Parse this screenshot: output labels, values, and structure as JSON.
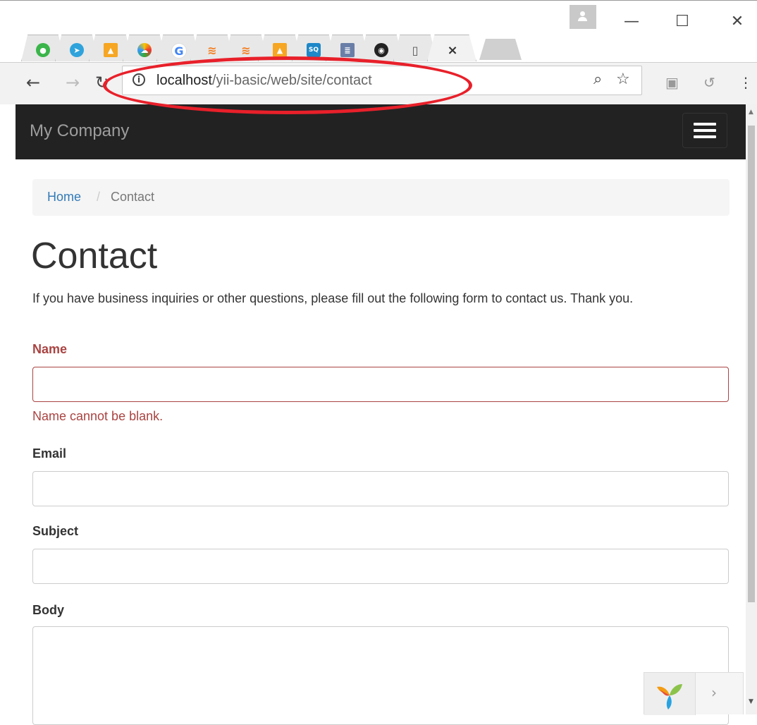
{
  "browser": {
    "address_host": "localhost",
    "address_path": "/yii-basic/web/site/contact",
    "tabs": [
      "whatsapp",
      "telegram",
      "phpmyadmin",
      "weather",
      "google",
      "stackoverflow",
      "stackoverflow",
      "phpmyadmin",
      "sq",
      "archive",
      "github",
      "blank-page",
      "active"
    ],
    "close_tab_glyph": "×",
    "window_controls": {
      "minimize": "—",
      "maximize": "☐",
      "close": "✕"
    },
    "annotation_color": "#e8202a"
  },
  "navbar": {
    "brand": "My Company",
    "background": "#222222"
  },
  "breadcrumb": {
    "home": "Home",
    "separator": "/",
    "current": "Contact"
  },
  "page": {
    "title": "Contact",
    "intro": "If you have business inquiries or other questions, please fill out the following form to contact us. Thank you."
  },
  "form": {
    "name_label": "Name",
    "name_value": "",
    "name_error": "Name cannot be blank.",
    "email_label": "Email",
    "email_value": "",
    "subject_label": "Subject",
    "subject_value": "",
    "body_label": "Body",
    "body_value": "",
    "error_color": "#a94442"
  },
  "debug_toolbar": {
    "logo": "yii-logo-icon",
    "arrow": "›"
  }
}
